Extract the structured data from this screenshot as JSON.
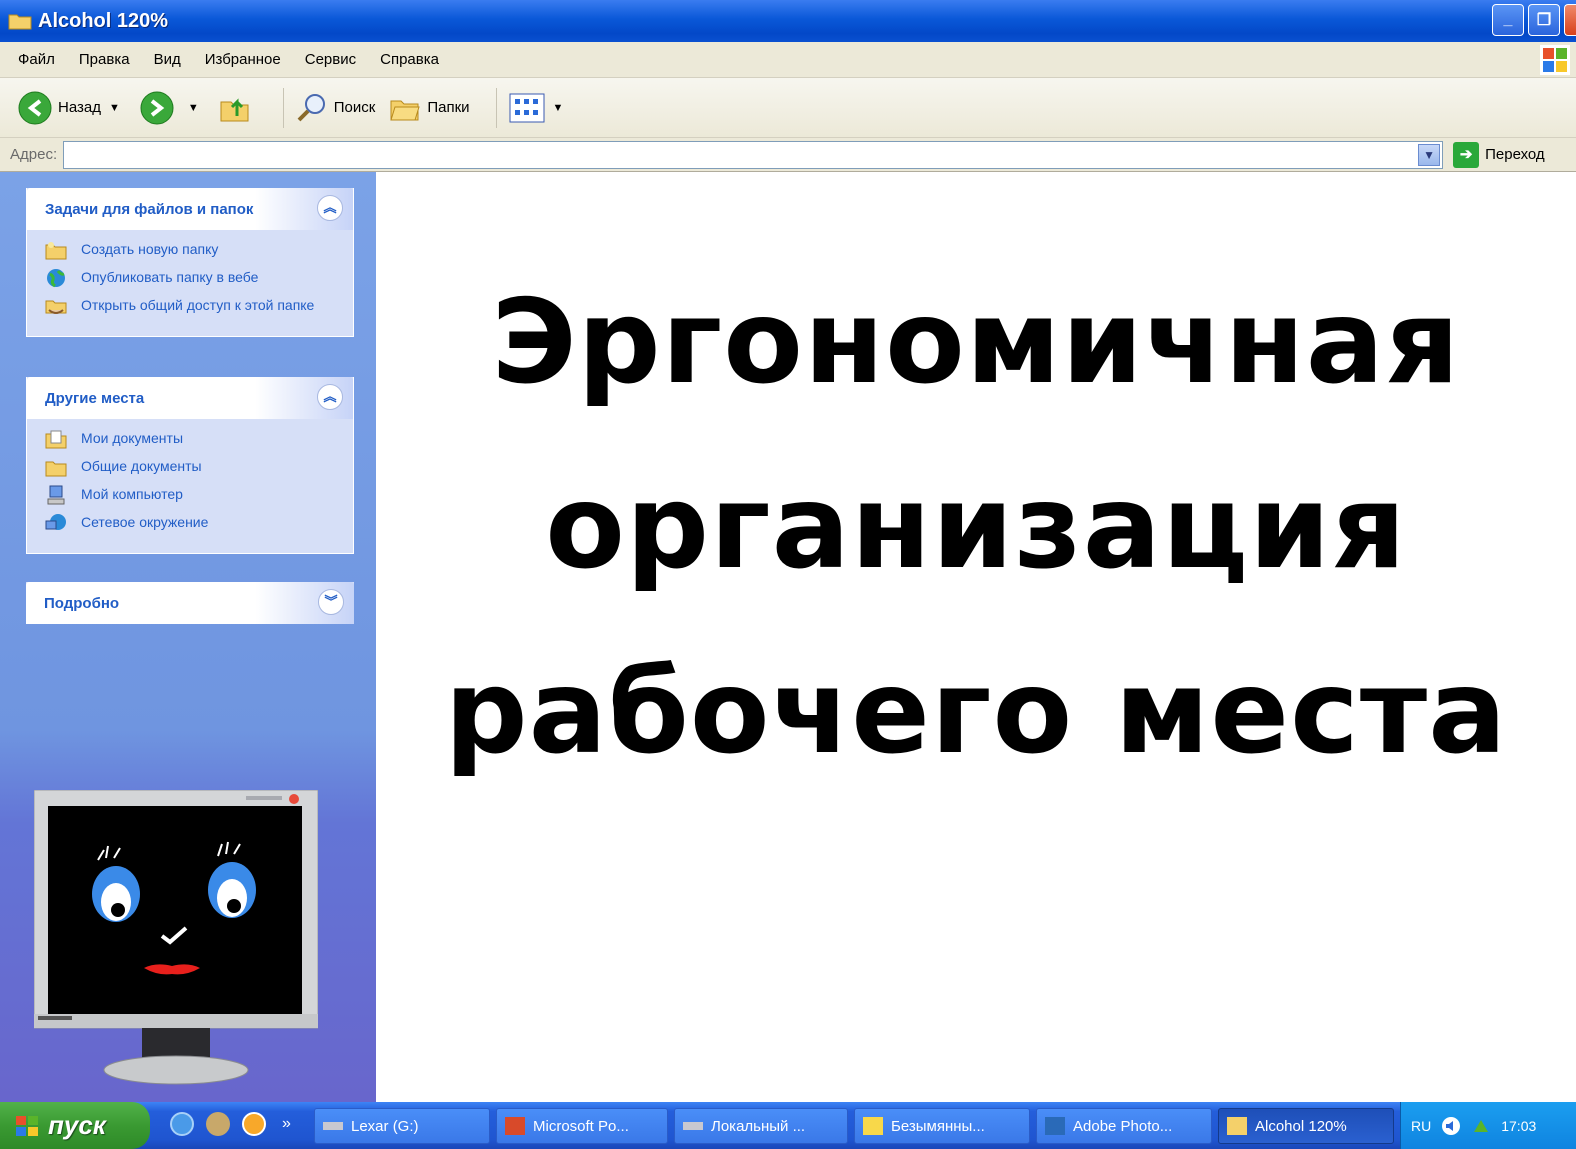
{
  "window": {
    "title": "Alcohol 120%"
  },
  "menubar": {
    "items": [
      "Файл",
      "Правка",
      "Вид",
      "Избранное",
      "Сервис",
      "Справка"
    ]
  },
  "toolbar": {
    "back_label": "Назад",
    "search_label": "Поиск",
    "folders_label": "Папки"
  },
  "addressbar": {
    "label": "Адрес:",
    "value": "",
    "go_label": "Переход"
  },
  "taskpane": {
    "tasks": {
      "title": "Задачи для файлов и папок",
      "items": [
        "Создать новую папку",
        "Опубликовать папку в вебе",
        "Открыть общий доступ к этой папке"
      ]
    },
    "places": {
      "title": "Другие места",
      "items": [
        "Мои документы",
        "Общие документы",
        "Мой компьютер",
        "Сетевое окружение"
      ]
    },
    "details": {
      "title": "Подробно"
    }
  },
  "content": {
    "heading_lines": [
      "Эргономичная",
      "организация",
      "рабочего места"
    ]
  },
  "taskbar": {
    "start_label": "пуск",
    "more": "»",
    "buttons": [
      "Lexar (G:)",
      "Microsoft Po...",
      "Локальный ...",
      "Безымянны...",
      "Adobe Photo...",
      "Alcohol 120%"
    ],
    "lang": "RU",
    "clock": "17:03"
  },
  "colors": {
    "titlebar": "#0a58d8",
    "taskpane_link": "#215dc6",
    "taskbar": "#245edb",
    "start": "#3a9a32"
  }
}
